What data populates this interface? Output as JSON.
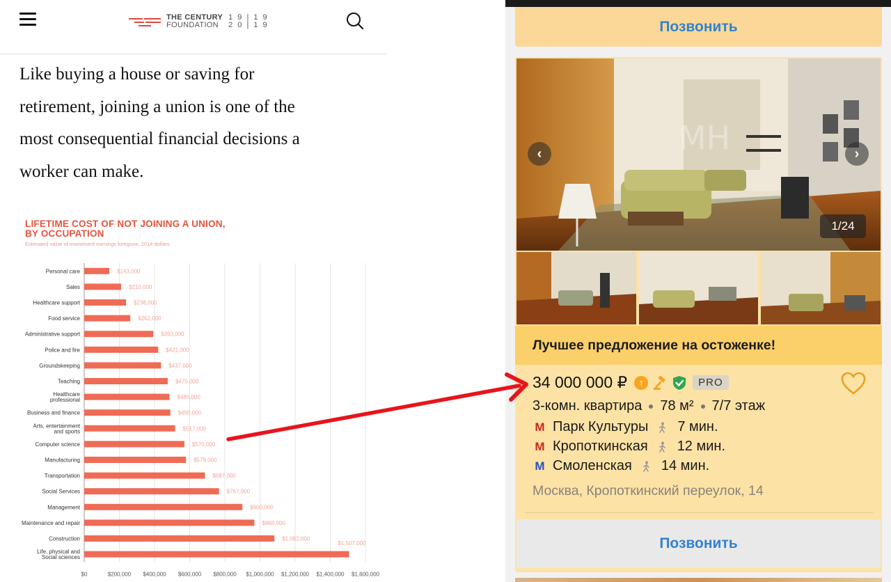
{
  "left_panel": {
    "header": {
      "brand_line1": "THE CENTURY",
      "brand_line2": "FOUNDATION",
      "years_top": "1 9 | 1 9",
      "years_bottom": "2 0 | 1 9",
      "accent_color": "#e2473a"
    },
    "article": {
      "line1": "Like buying a house or saving for",
      "line2": "retirement, joining a union is one of the",
      "line3": "most consequential financial decisions a",
      "line4": "worker can make."
    }
  },
  "chart_data": {
    "type": "bar",
    "orientation": "horizontal",
    "title_line1": "LIFETIME COST OF NOT JOINING A UNION,",
    "title_line2": "BY OCCUPATION",
    "subtitle": "Estimated value of investment earnings foregone, 2014 dollars",
    "bar_color": "#ef6b55",
    "categories": [
      "Personal care",
      "Sales",
      "Healthcare support",
      "Food service",
      "Administrative support",
      "Police and fire",
      "Groundskeeping",
      "Teaching",
      "Healthcare professional",
      "Business and finance",
      "Arts, entertainment and sports",
      "Computer science",
      "Manufacturing",
      "Transportation",
      "Social Services",
      "Management",
      "Maintenance and repair",
      "Construction",
      "Life, physical and Social sciences"
    ],
    "values": [
      143000,
      210000,
      238000,
      262000,
      393000,
      421000,
      437000,
      475000,
      485000,
      490000,
      517000,
      570000,
      579000,
      687000,
      767000,
      900000,
      968000,
      1082000,
      1507000
    ],
    "value_labels": [
      "$143,000",
      "$210,000",
      "$238,000",
      "$262,000",
      "$393,000",
      "$421,000",
      "$437,000",
      "$475,000",
      "$485,000",
      "$490,000",
      "$517,000",
      "$570,000",
      "$579,000",
      "$687,000",
      "$767,000",
      "$900,000",
      "$968,000",
      "$1,082,000",
      "$1,507,000"
    ],
    "x_ticks": [
      "$0",
      "$200,000",
      "$400,000",
      "$600,000",
      "$800,000",
      "$1,000,000",
      "$1,200,000",
      "$1,400,000",
      "$1,600,000"
    ],
    "xlim": [
      0,
      1600000
    ],
    "grid": true
  },
  "right_panel": {
    "call_label": "Позвонить",
    "photo_counter": "1/24",
    "watermark": "MH ESTATE",
    "promo": "Лучшее предложение на остоженке!",
    "price": "34 000 000 ₽",
    "pro_badge": "PRO",
    "details": {
      "rooms": "3-комн. квартира",
      "area": "78 м²",
      "floor": "7/7 этаж"
    },
    "metro": [
      {
        "name": "Парк Культуры",
        "time": "7 мин.",
        "color": "#c62a1e"
      },
      {
        "name": "Кропоткинская",
        "time": "12 мин.",
        "color": "#c62a1e"
      },
      {
        "name": "Смоленская",
        "time": "14 мин.",
        "color": "#2a52be"
      }
    ],
    "address": "Москва, Кропоткинский переулок, 14",
    "colors": {
      "card_bg": "#fde2a6",
      "promo_bg": "#fbcf6a",
      "link_blue": "#3182ce",
      "arrow_red": "#e8141c"
    }
  }
}
